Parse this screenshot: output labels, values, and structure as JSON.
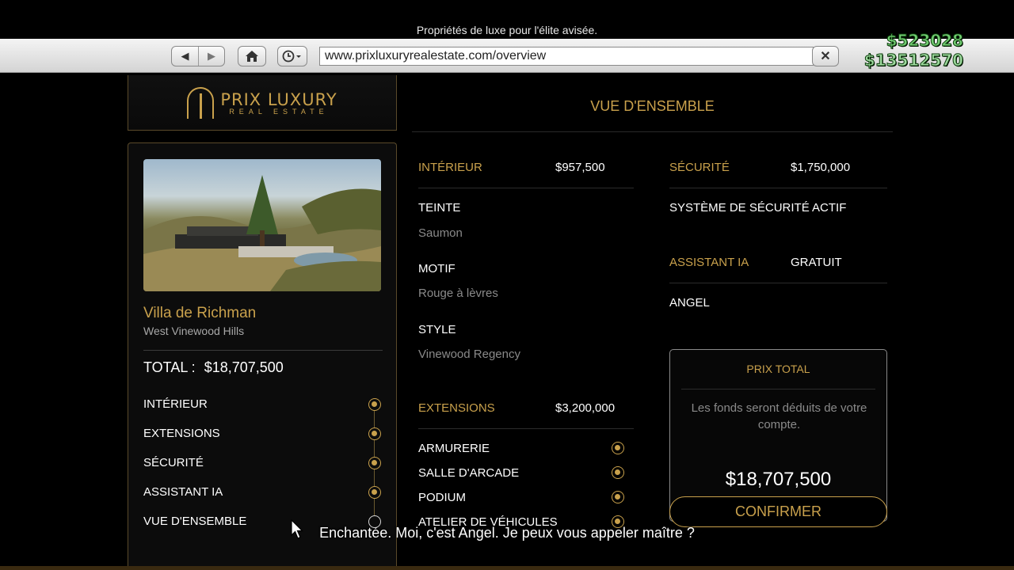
{
  "header": {
    "caption": "Propriétés de luxe pour l'élite avisée.",
    "url": "www.prixluxuryrealestate.com/overview",
    "money_primary": "$523028",
    "money_secondary": "$13512570",
    "icons": [
      "back-arrow-icon",
      "forward-arrow-icon",
      "home-icon",
      "history-clock-icon",
      "close-x-icon"
    ]
  },
  "logo": {
    "line1": "PRIX LUXURY",
    "line2": "REAL ESTATE"
  },
  "property": {
    "name": "Villa de Richman",
    "location": "West Vinewood Hills",
    "total_label": "TOTAL :",
    "total_value": "$18,707,500"
  },
  "steps": [
    {
      "label": "INTÉRIEUR",
      "done": true
    },
    {
      "label": "EXTENSIONS",
      "done": true
    },
    {
      "label": "SÉCURITÉ",
      "done": true
    },
    {
      "label": "ASSISTANT IA",
      "done": true
    },
    {
      "label": "VUE D'ENSEMBLE",
      "done": false
    }
  ],
  "overview": {
    "title": "VUE D'ENSEMBLE",
    "interior": {
      "label": "INTÉRIEUR",
      "price": "$957,500",
      "tint_label": "TEINTE",
      "tint_value": "Saumon",
      "pattern_label": "MOTIF",
      "pattern_value": "Rouge à lèvres",
      "style_label": "STYLE",
      "style_value": "Vinewood Regency"
    },
    "extensions": {
      "label": "EXTENSIONS",
      "price": "$3,200,000",
      "items": [
        "ARMURERIE",
        "SALLE D'ARCADE",
        "PODIUM",
        "ATELIER DE VÉHICULES"
      ]
    },
    "security": {
      "label": "SÉCURITÉ",
      "price": "$1,750,000",
      "system": "SYSTÈME DE SÉCURITÉ ACTIF"
    },
    "ai": {
      "label": "ASSISTANT IA",
      "price": "GRATUIT",
      "name": "ANGEL"
    }
  },
  "price_box": {
    "heading": "PRIX TOTAL",
    "note": "Les fonds seront déduits de votre compte.",
    "total": "$18,707,500",
    "confirm_label": "CONFIRMER"
  },
  "subtitle": "Enchantée. Moi, c'est Angel. Je peux vous appeler maître ?",
  "colors": {
    "gold": "#c9a14c",
    "money_green": "#72cc72",
    "background": "#000000"
  }
}
